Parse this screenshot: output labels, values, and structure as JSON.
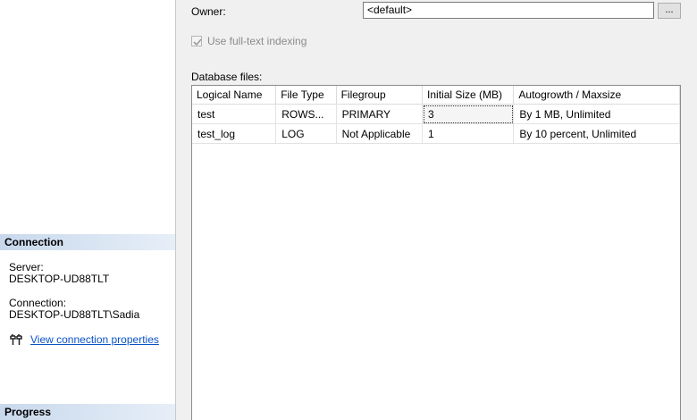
{
  "connection": {
    "header": "Connection",
    "server_label": "Server:",
    "server_value": "DESKTOP-UD88TLT",
    "connection_label": "Connection:",
    "connection_value": "DESKTOP-UD88TLT\\Sadia",
    "link_text": "View connection properties"
  },
  "progress": {
    "header": "Progress"
  },
  "form": {
    "owner_label": "Owner:",
    "owner_value": "<default>",
    "browse_label": "...",
    "fulltext_label": "Use full-text indexing",
    "fulltext_checked": true,
    "db_files_label": "Database files:"
  },
  "files_table": {
    "columns": [
      "Logical Name",
      "File Type",
      "Filegroup",
      "Initial Size (MB)",
      "Autogrowth / Maxsize"
    ],
    "rows": [
      [
        "test",
        "ROWS...",
        "PRIMARY",
        "3",
        "By 1 MB, Unlimited"
      ],
      [
        "test_log",
        "LOG",
        "Not Applicable",
        "1",
        "By 10 percent, Unlimited"
      ]
    ]
  }
}
